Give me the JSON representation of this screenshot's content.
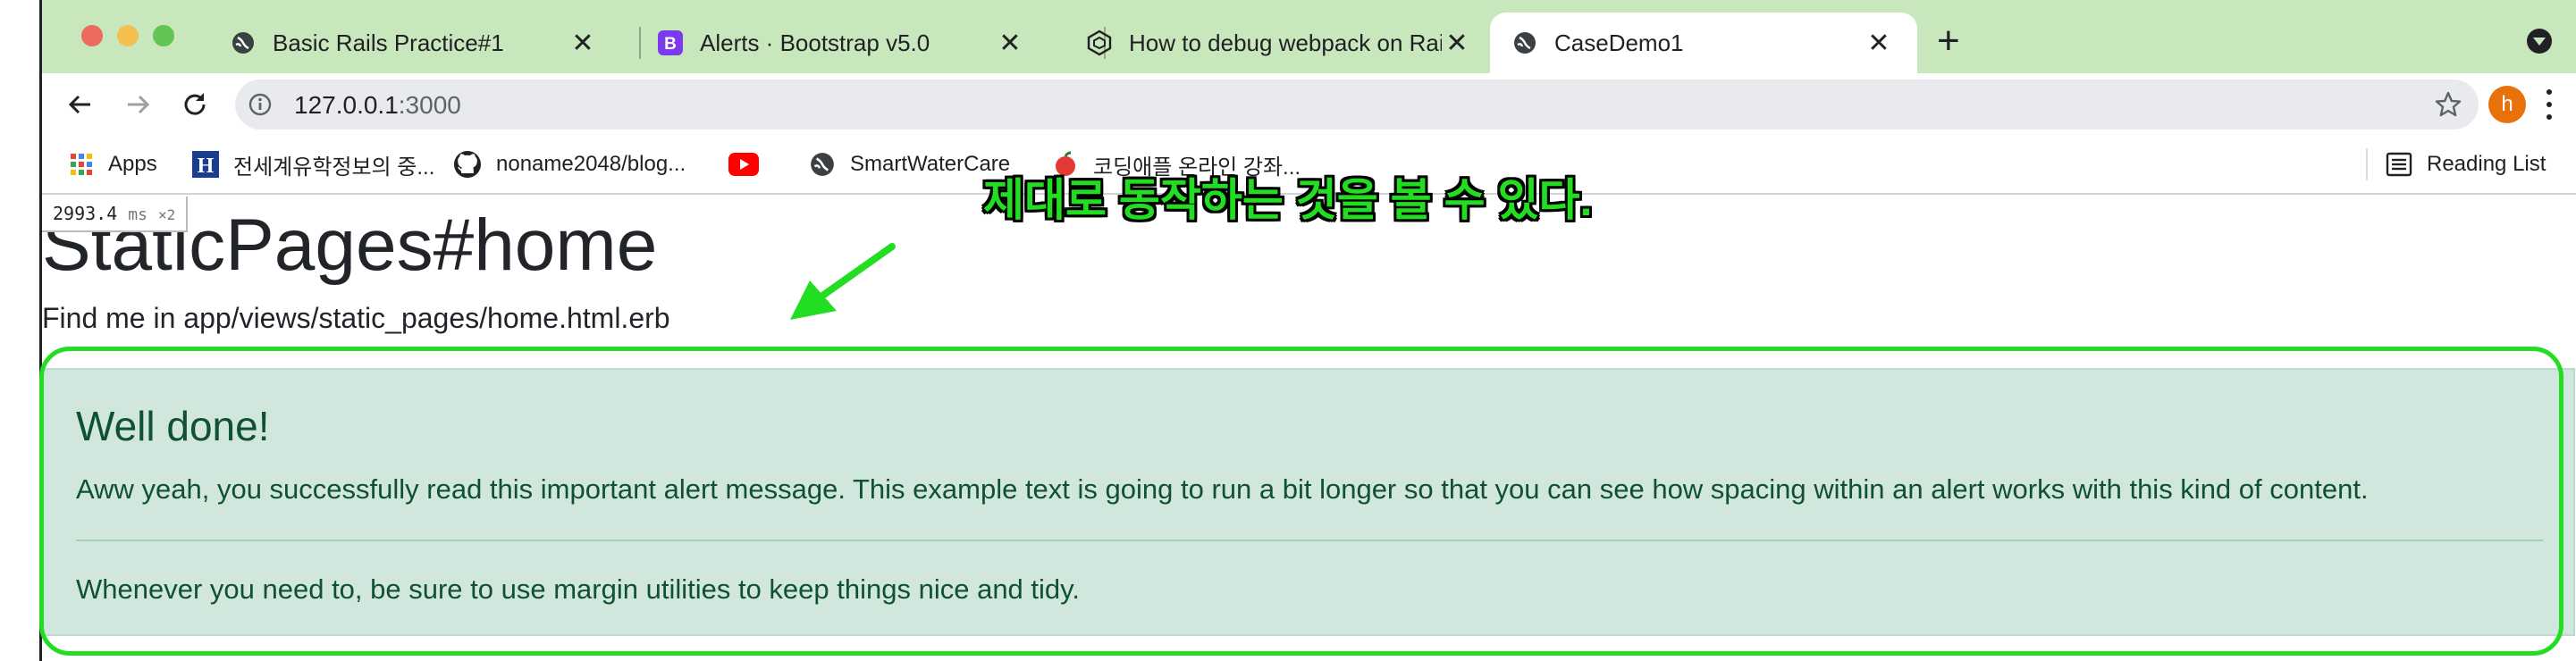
{
  "tabs": [
    {
      "title": "Basic Rails Practice#1",
      "icon": "globe-icon",
      "active": false
    },
    {
      "title": "Alerts · Bootstrap v5.0",
      "icon": "bootstrap-icon",
      "active": false
    },
    {
      "title": "How to debug webpack on Rails",
      "icon": "webpack-icon",
      "active": false
    },
    {
      "title": "CaseDemo1",
      "icon": "globe-icon",
      "active": true
    }
  ],
  "tab_close_glyph": "✕",
  "new_tab_glyph": "+",
  "address": {
    "host": "127.0.0.1",
    "port": ":3000"
  },
  "profile_initial": "h",
  "bookmarks": [
    {
      "label": "Apps",
      "icon": "apps-grid-icon"
    },
    {
      "label": "전세계유학정보의 중...",
      "icon": "h-logo-icon"
    },
    {
      "label": "noname2048/blog...",
      "icon": "github-icon"
    },
    {
      "label": "",
      "icon": "youtube-icon"
    },
    {
      "label": "SmartWaterCare",
      "icon": "globe-icon"
    },
    {
      "label": "코딩애플 온라인 강좌...",
      "icon": "apple-icon"
    }
  ],
  "reading_list": "Reading List",
  "profiler": {
    "value": "2993.4",
    "unit": "ms",
    "count": "×2"
  },
  "page": {
    "title": "StaticPages#home",
    "subtitle": "Find me in app/views/static_pages/home.html.erb"
  },
  "alert": {
    "heading": "Well done!",
    "body": "Aww yeah, you successfully read this important alert message. This example text is going to run a bit longer so that you can see how spacing within an alert works with this kind of content.",
    "footer": "Whenever you need to, be sure to use margin utilities to keep things nice and tidy."
  },
  "annotation": {
    "text": "제대로 동작하는 것을 볼 수 있다.",
    "color": "#22dd22"
  },
  "colors": {
    "tabstrip": "#c8e7bc",
    "alert_bg": "#d1e7dd",
    "alert_text": "#0f5132",
    "profile": "#e8710a"
  }
}
